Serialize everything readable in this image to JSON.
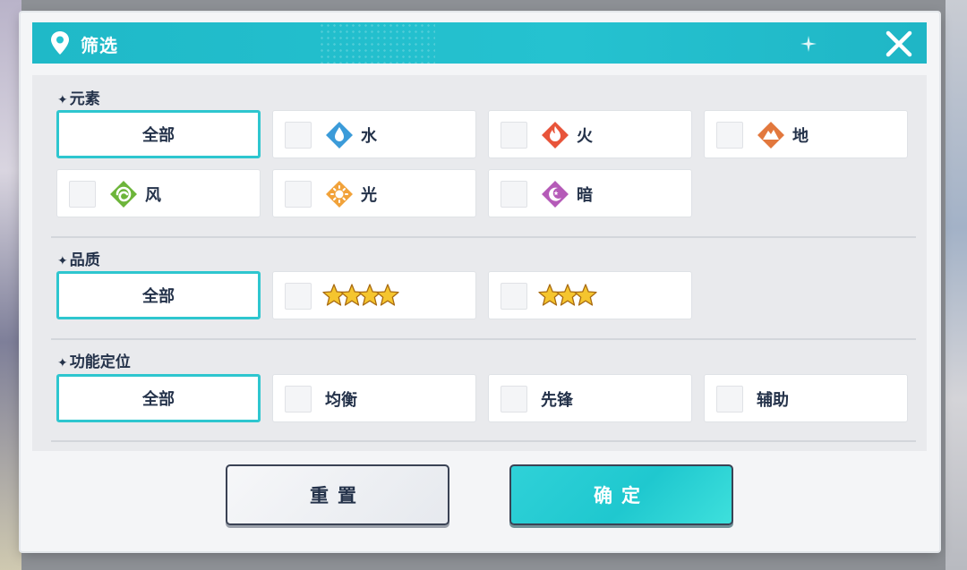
{
  "header": {
    "title": "筛选"
  },
  "sections": {
    "element": {
      "title": "元素",
      "all_label": "全部",
      "options": [
        {
          "label": "水",
          "icon": "water-drop-icon",
          "color": "#3b9bd9"
        },
        {
          "label": "火",
          "icon": "flame-icon",
          "color": "#e8543a"
        },
        {
          "label": "地",
          "icon": "mountain-icon",
          "color": "#e2783d"
        },
        {
          "label": "风",
          "icon": "wind-swirl-icon",
          "color": "#6db53a"
        },
        {
          "label": "光",
          "icon": "sun-icon",
          "color": "#f1a23a"
        },
        {
          "label": "暗",
          "icon": "moon-icon",
          "color": "#b55bb8"
        }
      ]
    },
    "quality": {
      "title": "品质",
      "all_label": "全部",
      "options": [
        {
          "stars": 4
        },
        {
          "stars": 3
        }
      ]
    },
    "role": {
      "title": "功能定位",
      "all_label": "全部",
      "options": [
        {
          "label": "均衡"
        },
        {
          "label": "先锋"
        },
        {
          "label": "辅助"
        }
      ]
    }
  },
  "buttons": {
    "reset": "重置",
    "confirm": "确定"
  },
  "colors": {
    "accent": "#25c2d0",
    "text": "#24324a",
    "star": "#f5c52e"
  }
}
